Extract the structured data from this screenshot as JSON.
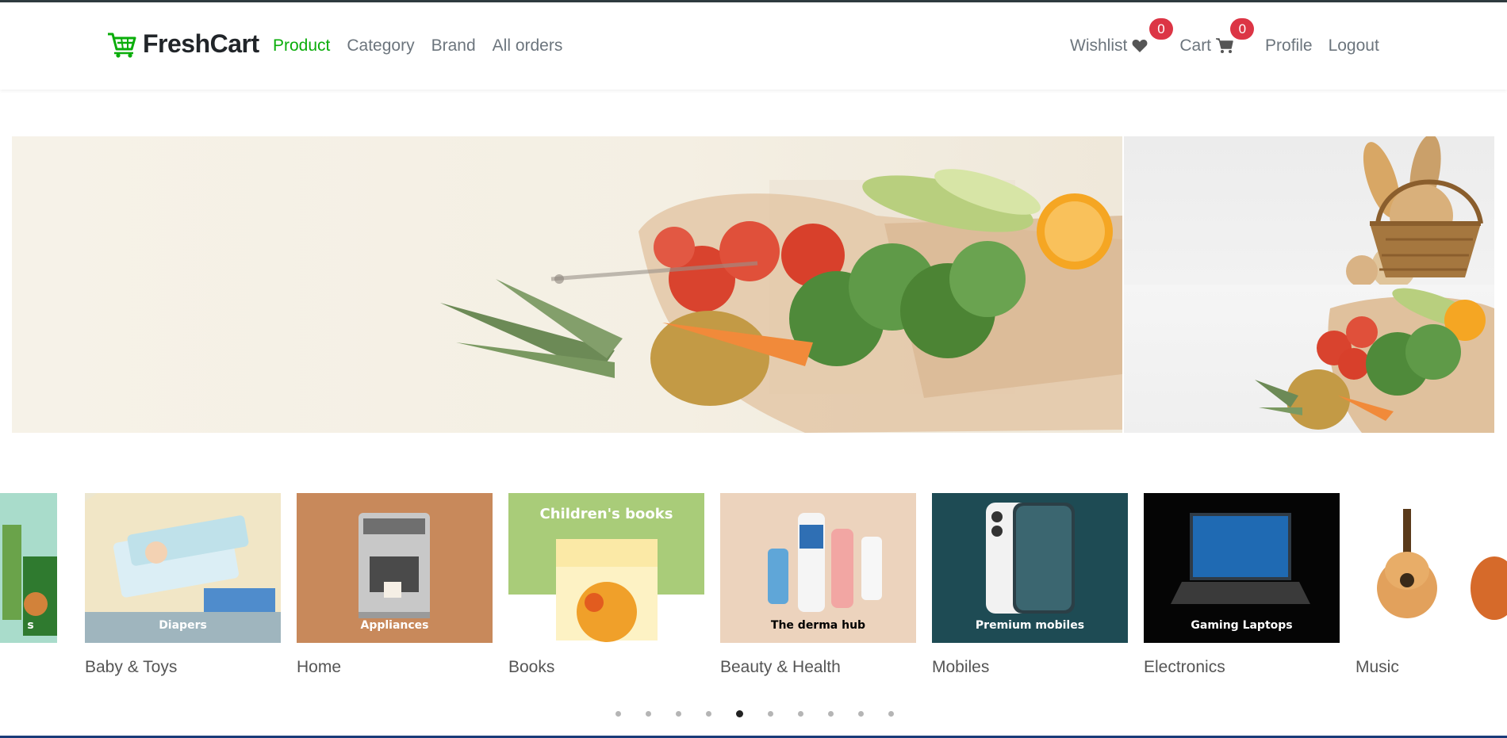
{
  "brand": {
    "name": "FreshCart",
    "logo_icon": "cart-icon",
    "accent": "#0aad0a"
  },
  "nav": {
    "left_links": [
      {
        "label": "Product",
        "active": true
      },
      {
        "label": "Category",
        "active": false
      },
      {
        "label": "Brand",
        "active": false
      },
      {
        "label": "All orders",
        "active": false
      }
    ],
    "wishlist": {
      "label": "Wishlist",
      "count": "0",
      "icon": "heart-icon"
    },
    "cart": {
      "label": "Cart",
      "count": "0",
      "icon": "shopping-cart-icon"
    },
    "profile_label": "Profile",
    "logout_label": "Logout",
    "badge_color": "#dc3545"
  },
  "hero": {
    "main_image": "grocery-bag-with-vegetables",
    "side_top_image": "bread-basket",
    "side_bottom_image": "grocery-bag-with-vegetables"
  },
  "categories": [
    {
      "label": "",
      "image": "partial-grocery-tile",
      "caption": "s"
    },
    {
      "label": "Baby & Toys",
      "image": "diapers",
      "caption": "Diapers"
    },
    {
      "label": "Home",
      "image": "coffee-machine",
      "caption": "Appliances"
    },
    {
      "label": "Books",
      "image": "children-book",
      "caption": "Children's books"
    },
    {
      "label": "Beauty & Health",
      "image": "skincare-bottles",
      "caption": "The derma hub"
    },
    {
      "label": "Mobiles",
      "image": "smartphone",
      "caption": "Premium mobiles"
    },
    {
      "label": "Electronics",
      "image": "laptop",
      "caption": "Gaming Laptops"
    },
    {
      "label": "Music",
      "image": "guitars",
      "caption": ""
    }
  ],
  "pagination": {
    "total": 10,
    "active_index": 4
  }
}
